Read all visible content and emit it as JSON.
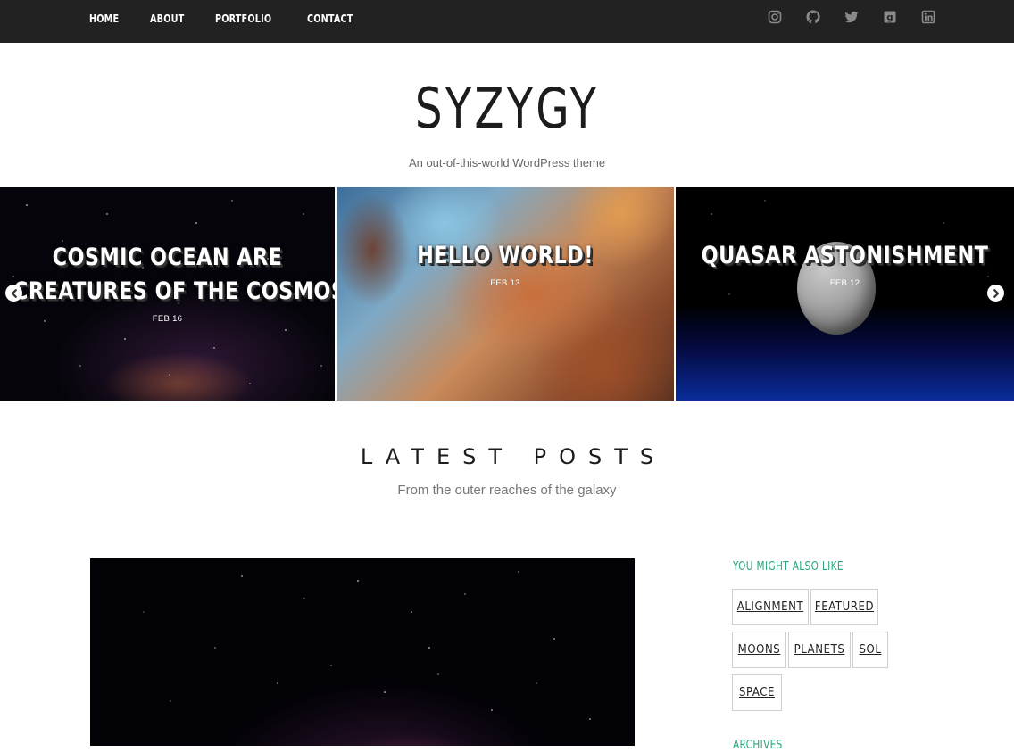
{
  "nav": {
    "items": [
      "HOME",
      "ABOUT",
      "PORTFOLIO",
      "CONTACT"
    ]
  },
  "social": {
    "icons": [
      "instagram-icon",
      "github-icon",
      "twitter-icon",
      "goodreads-icon",
      "linkedin-icon"
    ],
    "color": "#8a8a8a"
  },
  "header": {
    "title": "SYZYGY",
    "description": "An out-of-this-world WordPress theme"
  },
  "slider": {
    "slides": [
      {
        "title_line1": "COSMIC OCEAN ARE",
        "title_line2": "CREATURES OF THE COSMOS",
        "date": "FEB 16"
      },
      {
        "title_line1": "HELLO WORLD!",
        "date": "FEB 13"
      },
      {
        "title_line1": "QUASAR ASTONISHMENT",
        "date": "FEB 12"
      }
    ],
    "prev_icon": "arrow-left-circle-icon",
    "next_icon": "arrow-right-circle-icon"
  },
  "latest": {
    "title": "LATEST POSTS",
    "subtitle": "From the outer reaches of the galaxy"
  },
  "sidebar": {
    "widget_title": "YOU MIGHT ALSO LIKE",
    "tags": [
      "ALIGNMENT",
      "FEATURED",
      "MOONS",
      "PLANETS",
      "SOL",
      "SPACE"
    ],
    "next_widget_title": "ARCHIVES",
    "accent": "#2aa67d"
  }
}
